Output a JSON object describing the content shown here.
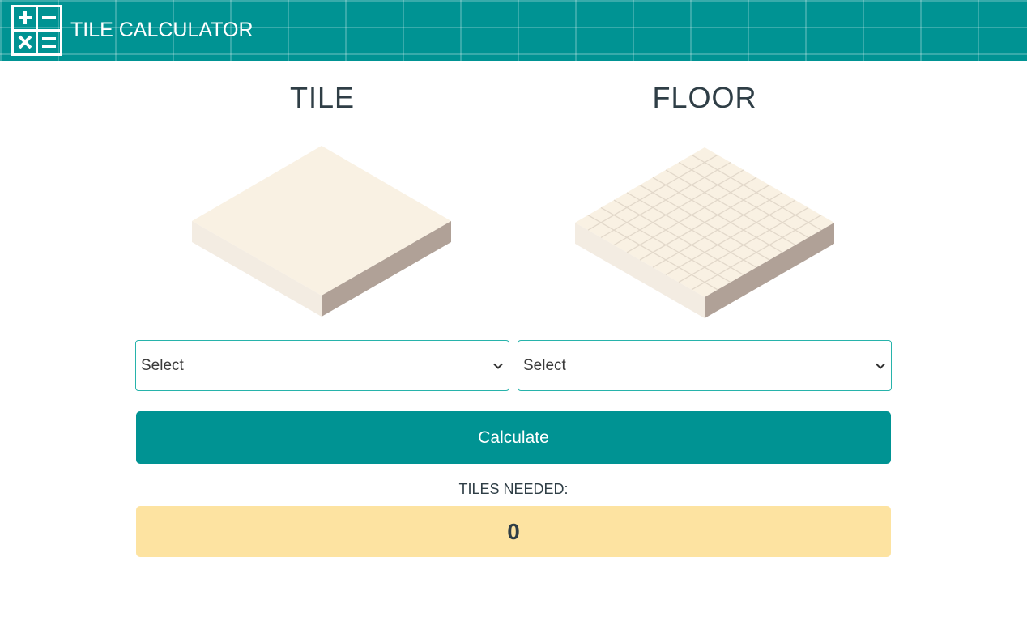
{
  "header": {
    "title": "TILE CALCULATOR",
    "logo_icon": "calculator-icon"
  },
  "columns": {
    "tile": {
      "title": "TILE",
      "illustration": "single-tile-illustration",
      "select_value": "Select"
    },
    "floor": {
      "title": "FLOOR",
      "illustration": "tiled-floor-illustration",
      "select_value": "Select"
    }
  },
  "calculate_button": {
    "label": "Calculate"
  },
  "result": {
    "label": "TILES NEEDED:",
    "value": "0"
  },
  "colors": {
    "primary": "#009393",
    "result_bg": "#fde3a1",
    "tile_top": "#f9f1e3",
    "tile_side_light": "#f3ece2",
    "tile_side_dark": "#b0a197",
    "text": "#2f3e46"
  }
}
